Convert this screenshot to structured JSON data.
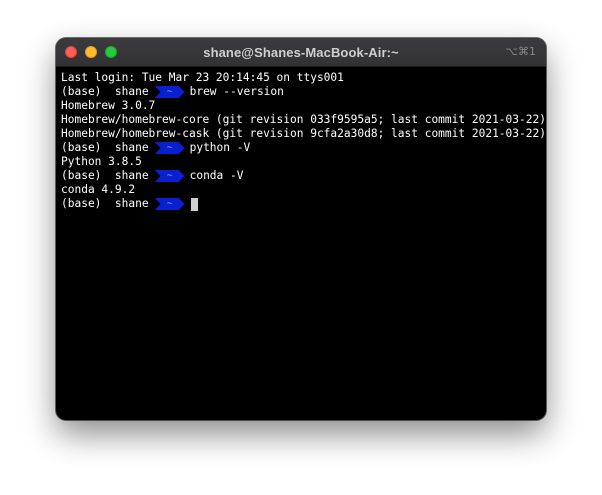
{
  "window": {
    "title": "shane@Shanes-MacBook-Air:~",
    "shortcut": "⌥⌘1"
  },
  "prompt": {
    "env": "(base)",
    "user": "shane",
    "dir": "~"
  },
  "lines": {
    "l0": "Last login: Tue Mar 23 20:14:45 on ttys001",
    "c1": "brew --version",
    "o1": "Homebrew 3.0.7",
    "o2": "Homebrew/homebrew-core (git revision 033f9595a5; last commit 2021-03-22)",
    "o3": "Homebrew/homebrew-cask (git revision 9cfa2a30d8; last commit 2021-03-22)",
    "c2": "python -V",
    "o4": "Python 3.8.5",
    "c3": "conda -V",
    "o5": "conda 4.9.2"
  },
  "colors": {
    "prompt_segment": "#0a1fd0",
    "background": "#000000",
    "text": "#ffffff"
  }
}
